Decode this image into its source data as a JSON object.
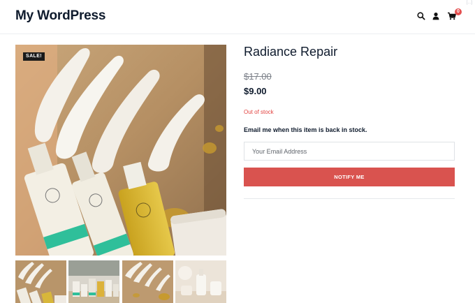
{
  "header": {
    "site_title": "My WordPress",
    "watermark": "[...]",
    "icons": [
      "search-icon",
      "account-icon",
      "cart-icon"
    ],
    "cart_count": "0"
  },
  "gallery": {
    "sale_badge": "SALE!",
    "thumbnail_count": 4
  },
  "product": {
    "title": "Radiance Repair",
    "regular_price": "$17.00",
    "sale_price": "$9.00",
    "stock_status": "Out of stock"
  },
  "notify": {
    "label": "Email me when this item is back in stock.",
    "email_placeholder": "Your Email Address",
    "email_value": "",
    "button_label": "NOTIFY ME"
  },
  "colors": {
    "accent": "#d9534f",
    "stock_text": "#e2423f",
    "badge_bg": "#e45050",
    "title_text": "#0f1b2d"
  }
}
